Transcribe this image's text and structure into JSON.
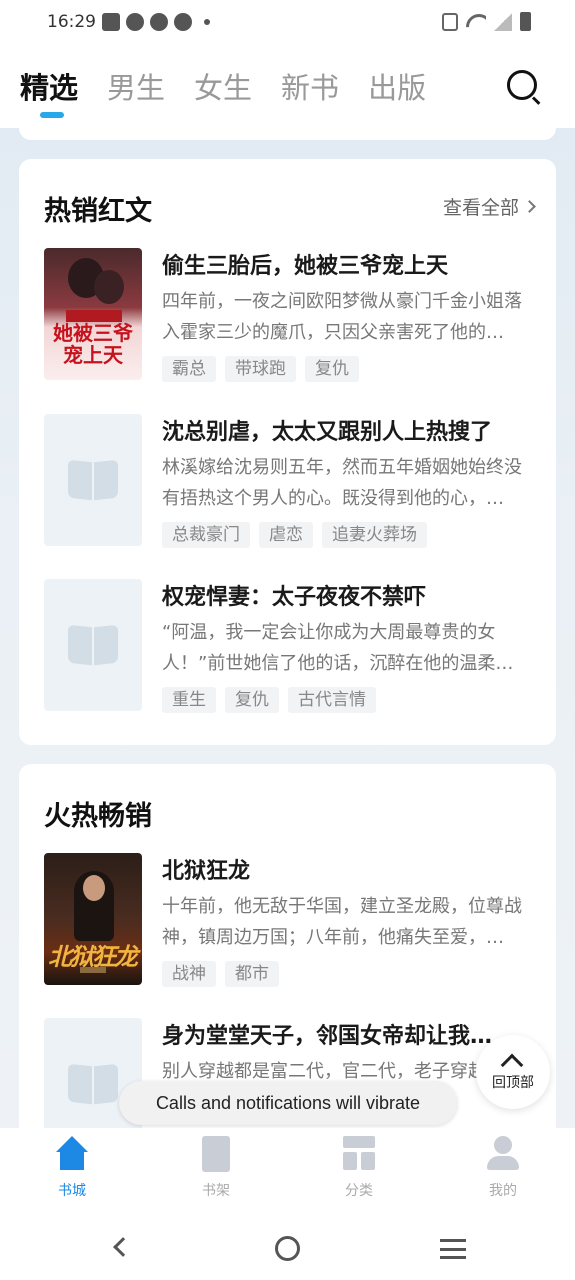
{
  "status_bar": {
    "time": "16:29"
  },
  "tabs": [
    {
      "label": "精选",
      "active": true
    },
    {
      "label": "男生",
      "active": false
    },
    {
      "label": "女生",
      "active": false
    },
    {
      "label": "新书",
      "active": false
    },
    {
      "label": "出版",
      "active": false
    }
  ],
  "accent_color": "#1e88e5",
  "sections": [
    {
      "title": "热销红文",
      "see_all": "查看全部",
      "books": [
        {
          "title": "偷生三胎后，她被三爷宠上天",
          "desc": "四年前，一夜之间欧阳梦微从豪门千金小姐落入霍家三少的魔爪，只因父亲害死了他的…",
          "tags": [
            "霸总",
            "带球跑",
            "复仇"
          ],
          "cover_text": "她被三爷宠上天"
        },
        {
          "title": "沈总别虐，太太又跟别人上热搜了",
          "desc": "林溪嫁给沈易则五年，然而五年婚姻她始终没有捂热这个男人的心。既没得到他的心，…",
          "tags": [
            "总裁豪门",
            "虐恋",
            "追妻火葬场"
          ]
        },
        {
          "title": "权宠悍妻：太子夜夜不禁吓",
          "desc": "“阿温，我一定会让你成为大周最尊贵的女人！”前世她信了他的话，沉醉在他的温柔…",
          "tags": [
            "重生",
            "复仇",
            "古代言情"
          ]
        }
      ]
    },
    {
      "title": "火热畅销",
      "books": [
        {
          "title": "北狱狂龙",
          "desc": "十年前，他无敌于华国，建立圣龙殿，位尊战神，镇周边万国；八年前，他痛失至爱，…",
          "tags": [
            "战神",
            "都市"
          ],
          "cover_text": "北狱狂龙"
        },
        {
          "title": "身为堂堂天子，邻国女帝却让我…",
          "desc": "别人穿越都是富二代，官二代，老子穿越…"
        }
      ]
    }
  ],
  "back_to_top": "回顶部",
  "toast": "Calls and notifications will vibrate",
  "bottom_nav": [
    {
      "label": "书城",
      "icon": "home-icon",
      "active": true
    },
    {
      "label": "书架",
      "icon": "bookshelf-icon",
      "active": false
    },
    {
      "label": "分类",
      "icon": "category-icon",
      "active": false
    },
    {
      "label": "我的",
      "icon": "profile-icon",
      "active": false
    }
  ]
}
